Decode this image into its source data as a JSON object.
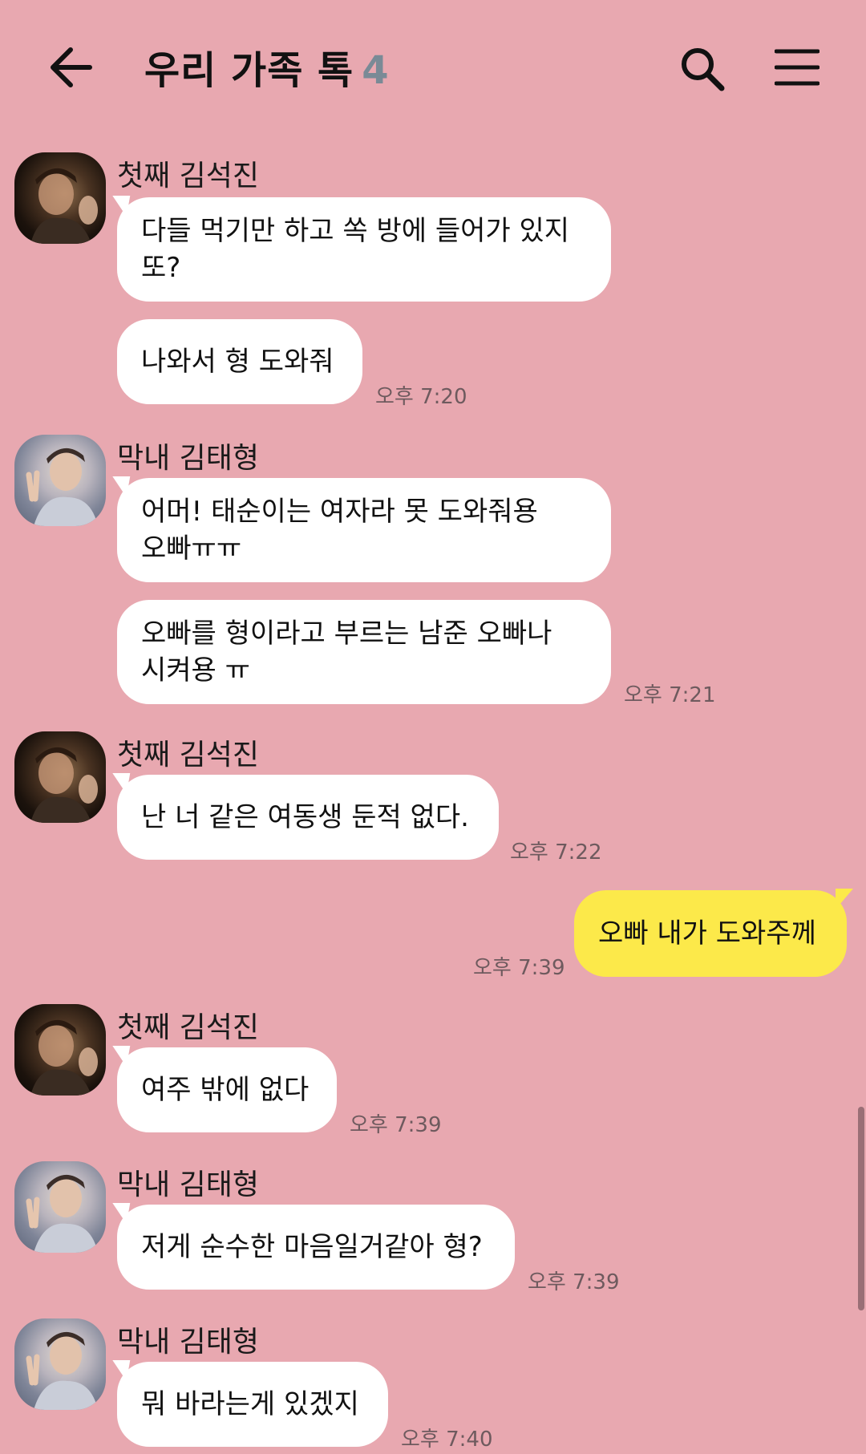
{
  "header": {
    "title": "우리 가족 톡",
    "member_count": "4",
    "icons": {
      "back": "arrow-left-icon",
      "search": "search-icon",
      "menu": "hamburger-menu-icon"
    }
  },
  "colors": {
    "background": "#E8A8B0",
    "incoming_bubble": "#FFFFFF",
    "outgoing_bubble": "#FCE94A",
    "count_color": "#7A8A96"
  },
  "messages": [
    {
      "sender": "첫째 김석진",
      "texts": [
        "다들 먹기만 하고 쏙 방에 들어가 있지\n또?",
        "나와서 형 도와줘"
      ],
      "time": "오후 7:20"
    },
    {
      "sender": "막내 김태형",
      "texts": [
        "어머! 태순이는 여자라 못 도와줘용\n오빠ㅠㅠ",
        "오빠를 형이라고 부르는 남준 오빠나\n시켜용 ㅠ"
      ],
      "time": "오후 7:21"
    },
    {
      "sender": "첫째 김석진",
      "texts": [
        "난 너 같은 여동생 둔적 없다."
      ],
      "time": "오후 7:22"
    },
    {
      "sender": "me",
      "texts": [
        "오빠 내가 도와주께"
      ],
      "time": "오후 7:39"
    },
    {
      "sender": "첫째 김석진",
      "texts": [
        "여주 밖에 없다"
      ],
      "time": "오후 7:39"
    },
    {
      "sender": "막내 김태형",
      "texts": [
        "저게 순수한 마음일거같아 형?"
      ],
      "time": "오후 7:39"
    },
    {
      "sender": "막내 김태형",
      "texts": [
        "뭐 바라는게 있겠지"
      ],
      "time": "오후 7:40"
    }
  ]
}
